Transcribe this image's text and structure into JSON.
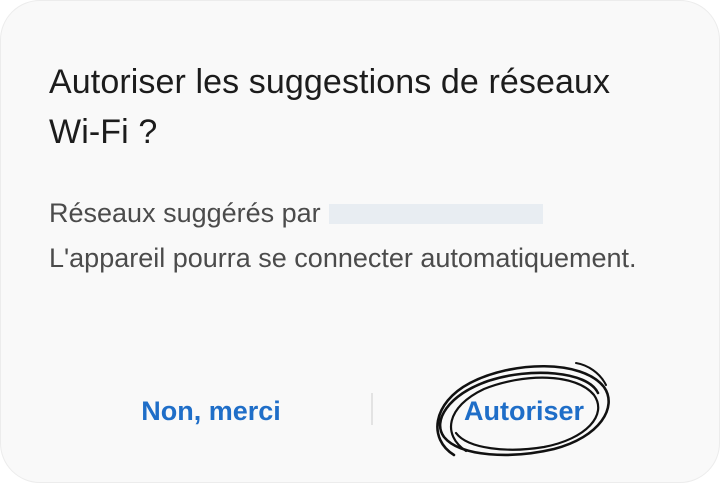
{
  "dialog": {
    "title": "Autoriser les suggestions de réseaux Wi-Fi ?",
    "body_line1": "Réseaux suggérés par",
    "body_line2": "L'appareil pourra se connecter automatiquement.",
    "deny_label": "Non, merci",
    "allow_label": "Autoriser"
  },
  "colors": {
    "accent": "#1f6ec8",
    "title_text": "#1c1c1c",
    "body_text": "#4b4b4b",
    "background": "#f9f9f9",
    "annotation": "#111111"
  }
}
